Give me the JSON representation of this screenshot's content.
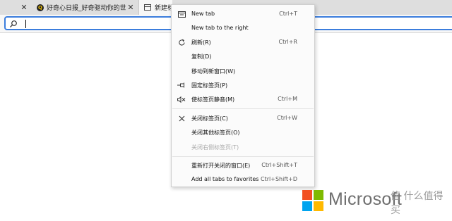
{
  "tabs": [
    {
      "close_glyph": "✕",
      "favicon": "qdaily-logo-icon",
      "favicon_letter": "Q",
      "title": "好奇心日报_好奇驱动你的世界_("
    },
    {
      "close_glyph": "✕",
      "favicon": "new-tab-page-icon",
      "title": "新建标"
    }
  ],
  "address_bar": {
    "value": "",
    "placeholder": "",
    "icon": "search-icon"
  },
  "context_menu": {
    "items": [
      {
        "label": "New tab",
        "shortcut": "Ctrl+T",
        "icon": "new-tab-icon",
        "disabled": false
      },
      {
        "label": "New tab to the right",
        "shortcut": "",
        "icon": "",
        "disabled": false
      },
      {
        "label": "刷新(R)",
        "shortcut": "Ctrl+R",
        "icon": "refresh-icon",
        "disabled": false
      },
      {
        "label": "复制(D)",
        "shortcut": "",
        "icon": "",
        "disabled": false
      },
      {
        "label": "移动到新窗口(W)",
        "shortcut": "",
        "icon": "",
        "disabled": false
      },
      {
        "label": "固定标签页(P)",
        "shortcut": "",
        "icon": "pin-icon",
        "disabled": false
      },
      {
        "label": "使标签页静音(M)",
        "shortcut": "Ctrl+M",
        "icon": "mute-icon",
        "disabled": false
      },
      {
        "label": "关闭标签页(C)",
        "shortcut": "Ctrl+W",
        "icon": "close-icon",
        "disabled": false
      },
      {
        "label": "关闭其他标签页(O)",
        "shortcut": "",
        "icon": "",
        "disabled": false
      },
      {
        "label": "关闭右侧标签页(T)",
        "shortcut": "",
        "icon": "",
        "disabled": true
      },
      {
        "label": "重新打开关闭的窗口(E)",
        "shortcut": "Ctrl+Shift+T",
        "icon": "",
        "disabled": false
      },
      {
        "label": "Add all tabs to favorites",
        "shortcut": "Ctrl+Shift+D",
        "icon": "",
        "disabled": false
      }
    ]
  },
  "branding": {
    "wordmark": "Microsoft",
    "logo_colors": [
      "#f25022",
      "#7fba00",
      "#00a4ef",
      "#ffb900"
    ],
    "watermark": "值 什么值得买"
  },
  "colors": {
    "accent": "#3b7ddd"
  }
}
